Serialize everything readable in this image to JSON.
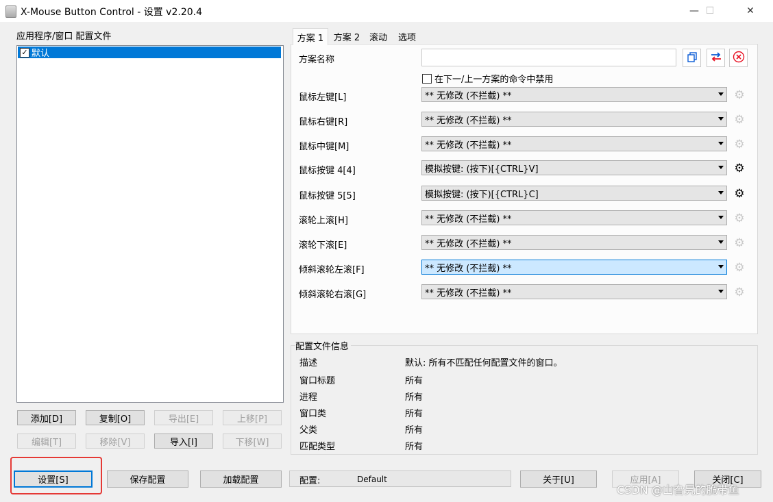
{
  "window": {
    "title": "X-Mouse Button Control - 设置 v2.20.4",
    "minimize": "—",
    "maximize": "☐",
    "close": "✕"
  },
  "left": {
    "group_label": "应用程序/窗口 配置文件",
    "profiles": [
      {
        "label": "默认",
        "checked": true,
        "selected": true
      }
    ],
    "buttons": {
      "add": "添加[D]",
      "copy": "复制[O]",
      "export": "导出[E]",
      "up": "上移[P]",
      "edit": "编辑[T]",
      "remove": "移除[V]",
      "import": "导入[I]",
      "down": "下移[W]"
    }
  },
  "tabs": [
    "方案 1",
    "方案 2",
    "滚动",
    "选项"
  ],
  "scheme": {
    "name_label": "方案名称",
    "name_value": "",
    "disable_checkbox": "在下一/上一方案的命令中禁用",
    "rows": [
      {
        "label": "鼠标左键[L]",
        "value": "** 无修改 (不拦截) **",
        "gear": "off",
        "highlight": false
      },
      {
        "label": "鼠标右键[R]",
        "value": "** 无修改 (不拦截) **",
        "gear": "off",
        "highlight": false
      },
      {
        "label": "鼠标中键[M]",
        "value": "** 无修改 (不拦截) **",
        "gear": "off",
        "highlight": false
      },
      {
        "label": "鼠标按键 4[4]",
        "value": "模拟按键: (按下)[{CTRL}V]",
        "gear": "on",
        "highlight": false
      },
      {
        "label": "鼠标按键 5[5]",
        "value": "模拟按键: (按下)[{CTRL}C]",
        "gear": "on",
        "highlight": false
      },
      {
        "label": "滚轮上滚[H]",
        "value": "** 无修改 (不拦截) **",
        "gear": "off",
        "highlight": false
      },
      {
        "label": "滚轮下滚[E]",
        "value": "** 无修改 (不拦截) **",
        "gear": "off",
        "highlight": false
      },
      {
        "label": "倾斜滚轮左滚[F]",
        "value": "** 无修改 (不拦截) **",
        "gear": "off",
        "highlight": true
      },
      {
        "label": "倾斜滚轮右滚[G]",
        "value": "** 无修改 (不拦截) **",
        "gear": "off",
        "highlight": false
      }
    ]
  },
  "profile_info": {
    "group_label": "配置文件信息",
    "rows": [
      {
        "k": "描述",
        "v": "默认: 所有不匹配任何配置文件的窗口。"
      },
      {
        "k": "窗口标题",
        "v": "所有"
      },
      {
        "k": "进程",
        "v": "所有"
      },
      {
        "k": "窗口类",
        "v": "所有"
      },
      {
        "k": "父类",
        "v": "所有"
      },
      {
        "k": "匹配类型",
        "v": "所有"
      }
    ]
  },
  "bottom": {
    "settings": "设置[S]",
    "save": "保存配置",
    "load": "加载配置",
    "config_label": "配置:",
    "config_value": "Default",
    "about": "关于[U]",
    "apply": "应用[A]",
    "close": "关闭[C]"
  },
  "watermark": "CSDN @山旮旯的脆带鱼",
  "colors": {
    "selection": "#0078d7",
    "highlight_combo": "#cce8ff",
    "annotation_red": "#e53935",
    "delete_red": "#e81123",
    "accent_blue": "#0b5cd5"
  }
}
